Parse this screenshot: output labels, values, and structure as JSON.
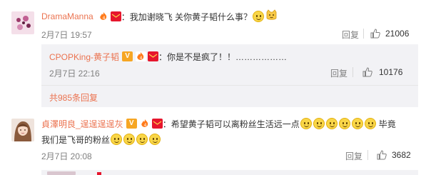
{
  "comments": [
    {
      "username": "DramaManna",
      "text": "：我加谢晓飞 关你黄子韬什么事？",
      "time": "2月7日 19:57",
      "reply_label": "回复",
      "likes": "21006",
      "emojis": [
        "smile",
        "cat"
      ]
    },
    {
      "username": "貞澤明良_逞逞逞逞灰",
      "text": "：希望黄子韬可以离粉丝生活远一点",
      "text_tail": "毕竟",
      "text_line2": "我们是飞哥的粉丝",
      "time": "2月7日 20:08",
      "reply_label": "回复",
      "likes": "3682"
    }
  ],
  "nested_reply": {
    "username": "CPOPKing-黄子韬",
    "text": "：你是不是疯了！！………………",
    "time": "2月7日 22:16",
    "reply_label": "回复",
    "likes": "10176",
    "total_replies": "共985条回复"
  },
  "icons": {
    "like": "thumbs-up-icon",
    "vip": "vip-badge-icon",
    "fans": "fans-badge-icon",
    "red": "red-envelope-badge-icon",
    "emoji": "smile-emoji-icon",
    "cat": "cat-emoji-icon"
  },
  "colors": {
    "username": "#eb7350",
    "gray": "#808080",
    "reply_bg": "#f2f2f5"
  }
}
